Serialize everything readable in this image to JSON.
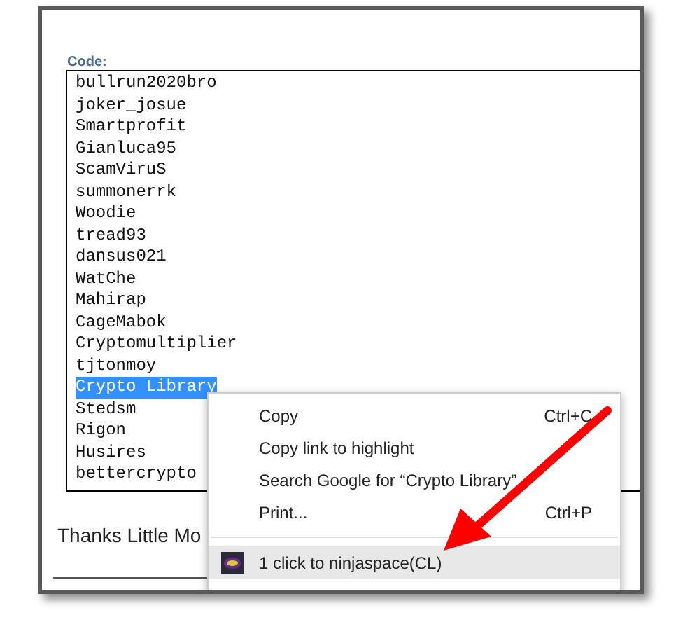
{
  "code_label": "Code:",
  "code_lines": [
    {
      "text": "bullrun2020bro",
      "selected": false
    },
    {
      "text": "joker_josue",
      "selected": false
    },
    {
      "text": "Smartprofit",
      "selected": false
    },
    {
      "text": "Gianluca95",
      "selected": false
    },
    {
      "text": "ScamViruS",
      "selected": false
    },
    {
      "text": "summonerrk",
      "selected": false
    },
    {
      "text": "Woodie",
      "selected": false
    },
    {
      "text": "tread93",
      "selected": false
    },
    {
      "text": "dansus021",
      "selected": false
    },
    {
      "text": "WatChe",
      "selected": false
    },
    {
      "text": "Mahirap",
      "selected": false
    },
    {
      "text": "CageMabok",
      "selected": false
    },
    {
      "text": "Cryptomultiplier",
      "selected": false
    },
    {
      "text": "tjtonmoy",
      "selected": false
    },
    {
      "text": "Crypto Library",
      "selected": true
    },
    {
      "text": "Stedsm",
      "selected": false
    },
    {
      "text": "Rigon",
      "selected": false
    },
    {
      "text": "Husires",
      "selected": false
    },
    {
      "text": "bettercrypto",
      "selected": false
    }
  ],
  "post_text": "Thanks Little Mo",
  "context_menu": [
    {
      "kind": "item",
      "label": "Copy",
      "shortcut": "Ctrl+C",
      "highlighted": false
    },
    {
      "kind": "item",
      "label": "Copy link to highlight",
      "highlighted": false
    },
    {
      "kind": "item",
      "label": "Search Google for “Crypto Library”",
      "highlighted": false
    },
    {
      "kind": "item",
      "label": "Print...",
      "shortcut": "Ctrl+P",
      "highlighted": false
    },
    {
      "kind": "separator"
    },
    {
      "kind": "extension",
      "label": "1 click to ninjaspace(CL)",
      "highlighted": true
    }
  ]
}
